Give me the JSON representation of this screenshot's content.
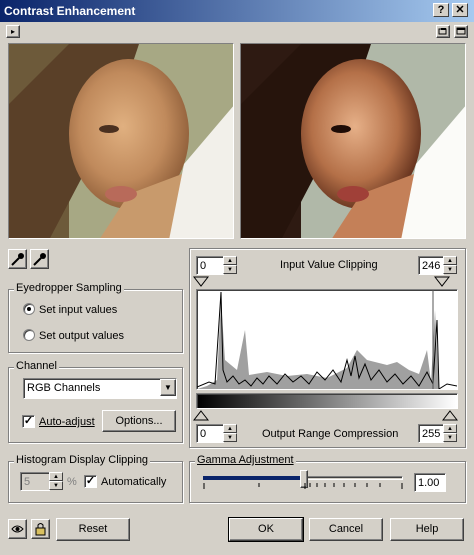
{
  "window": {
    "title": "Contrast Enhancement",
    "help_btn": "?",
    "close_btn": "✕"
  },
  "toolbar": {
    "expand_btn": "▸"
  },
  "eyedropper": {
    "title": "Eyedropper Sampling",
    "set_input": "Set input values",
    "set_output": "Set output values",
    "selected": "input"
  },
  "channel": {
    "title": "Channel",
    "selected": "RGB Channels",
    "auto_adjust_label": "Auto-adjust",
    "auto_adjust_checked": true,
    "options_btn": "Options..."
  },
  "histogram_clipping": {
    "title": "Histogram Display Clipping",
    "value": "5",
    "unit": "%",
    "automatically_label": "Automatically",
    "automatically_checked": true
  },
  "input_clipping": {
    "label": "Input Value Clipping",
    "low": "0",
    "high": "246"
  },
  "output_compression": {
    "label": "Output Range Compression",
    "low": "0",
    "high": "255"
  },
  "gamma": {
    "title": "Gamma Adjustment",
    "value": "1.00",
    "slider_position": 0.5
  },
  "footer": {
    "reset": "Reset",
    "ok": "OK",
    "cancel": "Cancel",
    "help": "Help"
  },
  "colors": {
    "dialog_bg": "#d4d0c8",
    "title_start": "#0a246a",
    "title_end": "#a6caf0"
  }
}
